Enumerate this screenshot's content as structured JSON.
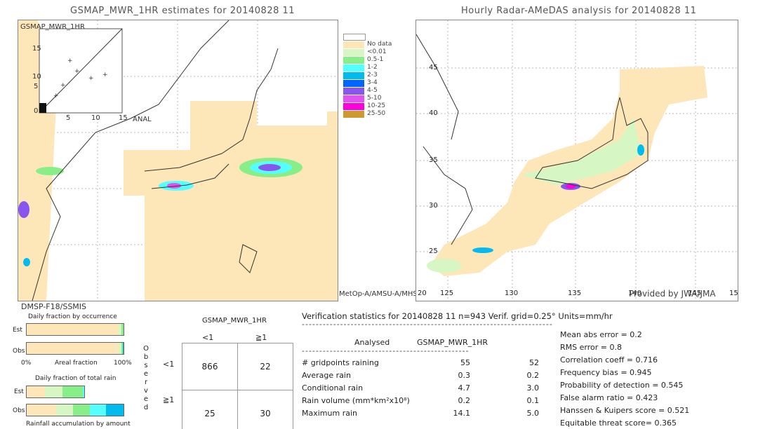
{
  "left_panel": {
    "title": "GSMAP_MWR_1HR estimates for 20140828 11",
    "inset_label": "GSMAP_MWR_1HR",
    "inset_x_label": "ANAL",
    "inset_ticks_y": [
      "15",
      "10",
      "5",
      "0"
    ],
    "inset_ticks_x": [
      "5",
      "10",
      "15"
    ],
    "sensor_bottom": "MetOp-A/AMSU-A/MHS",
    "sensor_left": "DMSP-F18/SSMIS"
  },
  "right_panel": {
    "title": "Hourly Radar-AMeDAS analysis for 20140828 11",
    "lat_ticks": [
      "45",
      "40",
      "35",
      "30",
      "25",
      "20"
    ],
    "lon_ticks": [
      "125",
      "130",
      "135",
      "140",
      "145",
      "15"
    ],
    "credit": "Provided by JWA/JMA"
  },
  "legend": {
    "items": [
      {
        "label": "No data",
        "color": "#fde6b8"
      },
      {
        "label": "<0.01",
        "color": "#d6f7c4"
      },
      {
        "label": "0.5-1",
        "color": "#88ee88"
      },
      {
        "label": "1-2",
        "color": "#55ffff"
      },
      {
        "label": "2-3",
        "color": "#00bbee"
      },
      {
        "label": "3-4",
        "color": "#0066ff"
      },
      {
        "label": "4-5",
        "color": "#8855ee"
      },
      {
        "label": "5-10",
        "color": "#dd55ee"
      },
      {
        "label": "10-25",
        "color": "#ff00dd"
      },
      {
        "label": "25-50",
        "color": "#cc9933"
      }
    ]
  },
  "occurrence": {
    "title": "Daily fraction by occurrence",
    "est_label": "Est",
    "obs_label": "Obs",
    "axis_left": "0%",
    "axis_mid": "Areal fraction",
    "axis_right": "100%"
  },
  "total_rain": {
    "title": "Daily fraction of total rain",
    "est_label": "Est",
    "obs_label": "Obs",
    "caption": "Rainfall accumulation by amount"
  },
  "contingency": {
    "title": "GSMAP_MWR_1HR",
    "col_headers": [
      "<1",
      "≧1"
    ],
    "row_headers": [
      "<1",
      "≧1"
    ],
    "observed_label": [
      "O",
      "b",
      "s",
      "e",
      "r",
      "v",
      "e",
      "d"
    ],
    "cells": [
      [
        "866",
        "22"
      ],
      [
        "25",
        "30"
      ]
    ]
  },
  "verification": {
    "header": "Verification statistics for 20140828 11   n=943   Verif. grid=0.25°   Units=mm/hr",
    "col_analysed": "Analysed",
    "col_est": "GSMAP_MWR_1HR",
    "rows": [
      {
        "label": "# gridpoints raining",
        "a": "55",
        "e": "52"
      },
      {
        "label": "Average rain",
        "a": "0.3",
        "e": "0.2"
      },
      {
        "label": "Conditional rain",
        "a": "4.7",
        "e": "3.0"
      },
      {
        "label": "Rain volume (mm*km²x10⁸)",
        "a": "0.2",
        "e": "0.1"
      },
      {
        "label": "Maximum rain",
        "a": "14.1",
        "e": "5.0"
      }
    ],
    "scores": [
      "Mean abs error = 0.2",
      "RMS error = 0.8",
      "Correlation coeff = 0.716",
      "Frequency bias = 0.945",
      "Probability of detection = 0.545",
      "False alarm ratio = 0.423",
      "Hanssen & Kuipers score = 0.521",
      "Equitable threat score= 0.365"
    ]
  }
}
